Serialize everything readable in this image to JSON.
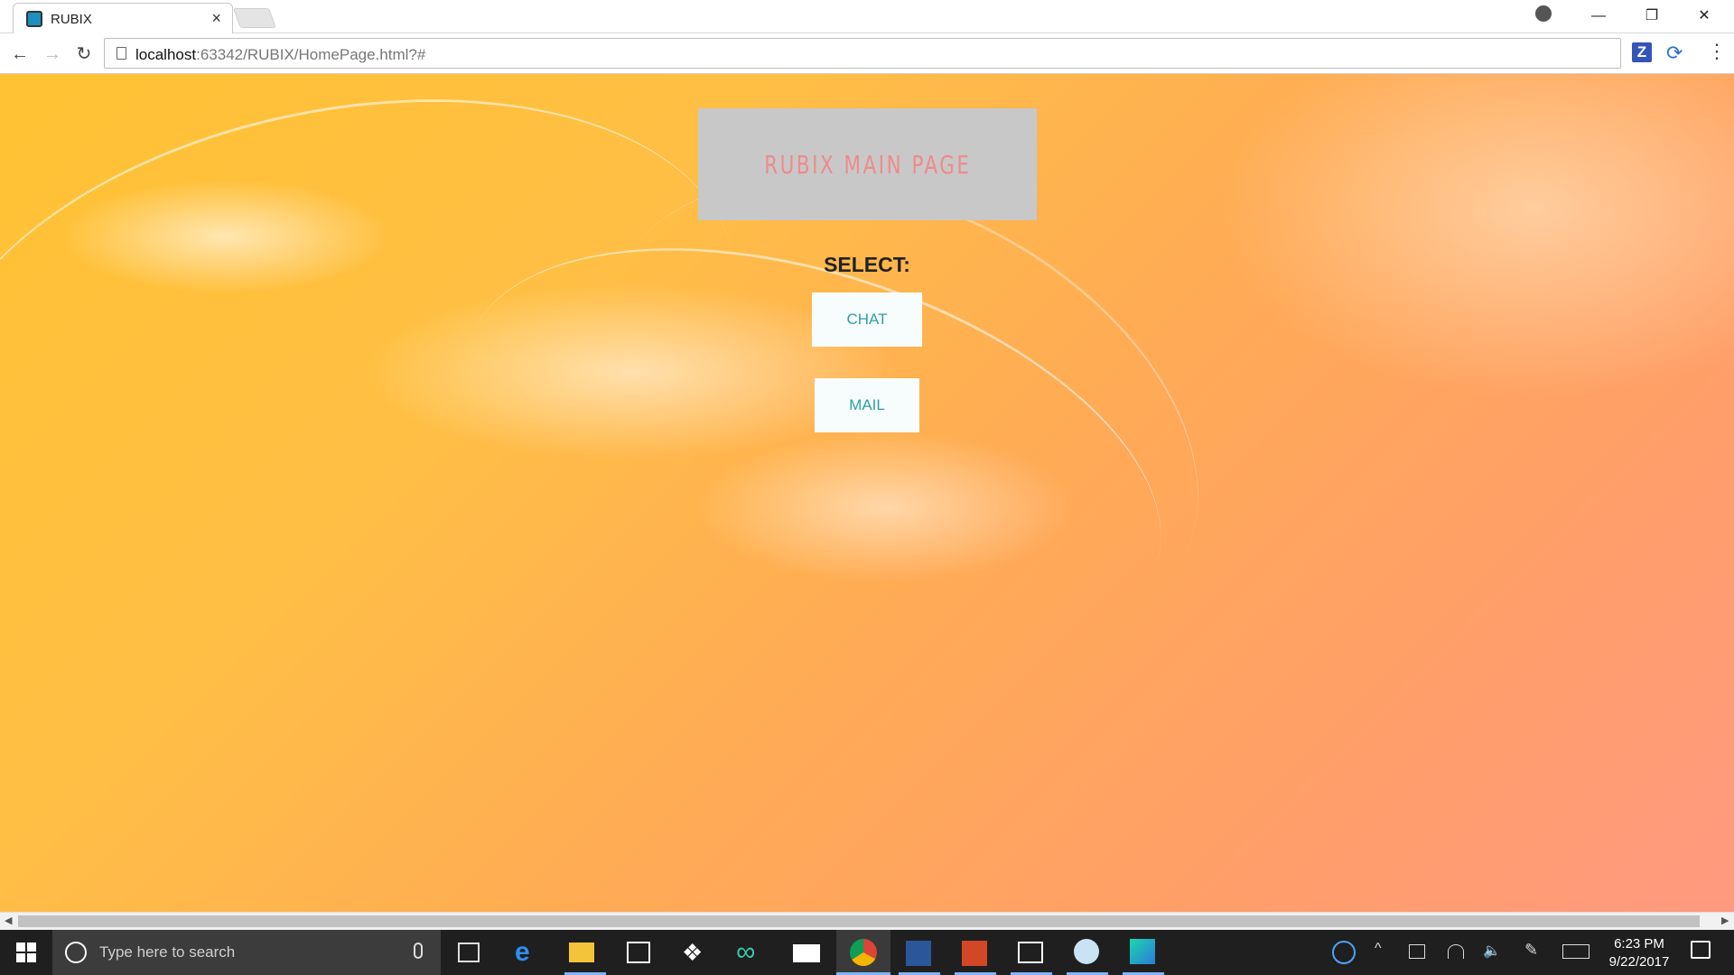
{
  "browser": {
    "tab_title": "RUBIX",
    "tab_close": "×",
    "url_host": "localhost",
    "url_rest": ":63342/RUBIX/HomePage.html?#",
    "back": "←",
    "forward": "→",
    "reload": "↻",
    "ext_z": "Z",
    "menu": "⋮",
    "minimize": "—",
    "restore": "❐",
    "close": "✕"
  },
  "page": {
    "header_title": "RUBIX MAIN PAGE",
    "select_label": "SELECT:",
    "buttons": [
      {
        "label": "CHAT"
      },
      {
        "label": "MAIL"
      }
    ]
  },
  "colors": {
    "header_bg": "#c8c8c8",
    "header_text": "#f08a8a",
    "button_text": "#2f9ea8",
    "button_bg": "#f7fdfc"
  },
  "taskbar": {
    "search_placeholder": "Type here to search",
    "time": "6:23 PM",
    "date": "9/22/2017",
    "apps": [
      "task-view-icon",
      "edge-icon",
      "file-explorer-icon",
      "store-icon",
      "dropbox-icon",
      "infinity-icon",
      "mail-icon",
      "chrome-icon",
      "word-icon",
      "powerpoint-icon",
      "photos-icon",
      "paint-icon",
      "webstorm-icon"
    ],
    "active_app": "chrome-icon"
  }
}
